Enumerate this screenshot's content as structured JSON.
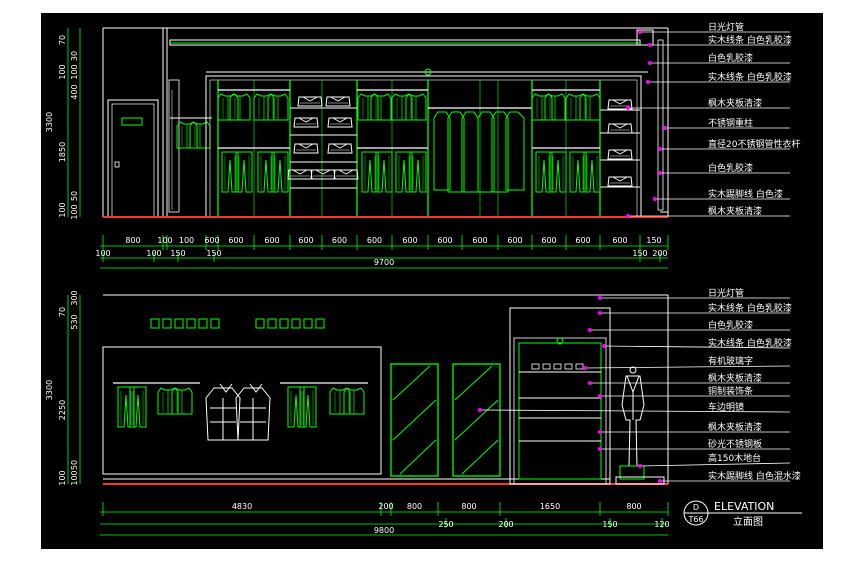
{
  "colors": {
    "background": "#000000",
    "line": "#ffffff",
    "green": "#00ff00",
    "magenta": "#ff00ff",
    "red": "#ff3333",
    "yellow": "#ffff00",
    "cyan": "#00ffff"
  },
  "top": {
    "vdims": [
      "70",
      "100",
      "3300",
      "100",
      "1850",
      "400",
      "100",
      "30",
      "100",
      "50"
    ],
    "labels": [
      "日光灯管",
      "实木线条 白色乳胶漆",
      "白色乳胶漆",
      "实木线条 白色乳胶漆",
      "枫木夹板清漆",
      "不锈钢重柱",
      "直径20不锈钢管性衣杆",
      "白色乳胶漆",
      "实木踢脚线 白色漆",
      "枫木夹板清漆"
    ],
    "hdims_top": [
      "800",
      "100",
      "100",
      "600",
      "600",
      "600",
      "600",
      "600",
      "600",
      "600",
      "600",
      "600",
      "600",
      "600",
      "600",
      "600",
      "150"
    ],
    "hdims_bottom": [
      "100",
      "100",
      "150",
      "150",
      "150",
      "200"
    ],
    "total": "9700"
  },
  "bottom": {
    "vdims": [
      "300",
      "70",
      "530",
      "3300",
      "2250",
      "100",
      "50",
      "100"
    ],
    "labels": [
      "日光灯管",
      "实木线条 白色乳胶漆",
      "白色乳胶漆",
      "实木线条 白色乳胶漆",
      "有机玻璃字",
      "枫木夹板清漆",
      "铜制装饰条",
      "车边明镜",
      "枫木夹板清漆",
      "砂光不锈钢板",
      "高150木地台",
      "实木踢脚线 白色混水漆"
    ],
    "hdims_top": [
      "4830",
      "200",
      "800",
      "800",
      "1650",
      "800"
    ],
    "hdims_bottom": [
      "250",
      "200",
      "150",
      "120"
    ],
    "total": "9800"
  },
  "titleblock": {
    "code": "D",
    "sheet": "T66",
    "title": "ELEVATION",
    "subtitle": "立面图"
  }
}
